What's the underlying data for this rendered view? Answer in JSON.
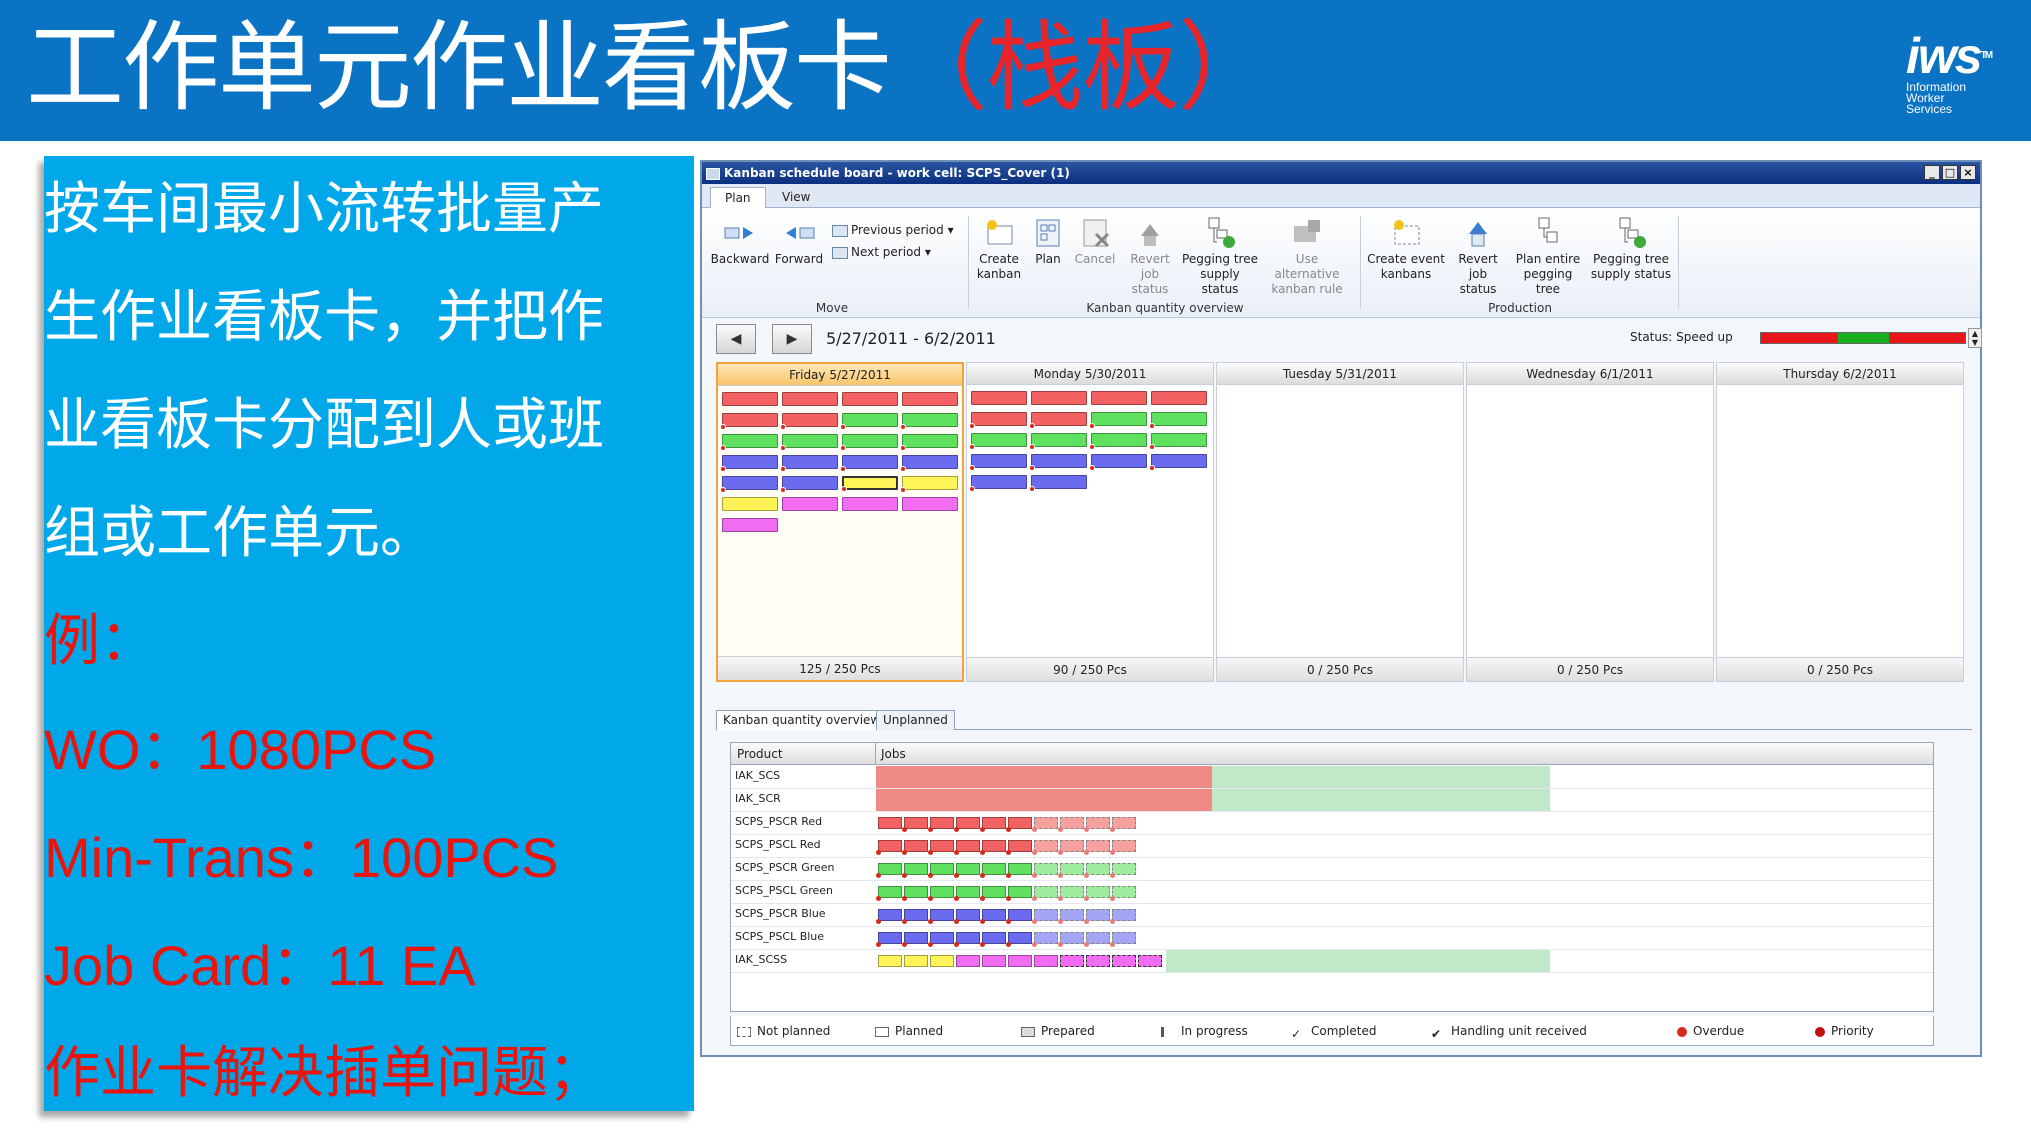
{
  "slide": {
    "title_main": "工作单元作业看板卡",
    "title_accent": "（栈板）",
    "logo": {
      "mark": "iws",
      "tm": "TM",
      "line1": "Information",
      "line2": "Worker",
      "line3": "Services"
    }
  },
  "panel": {
    "lines": [
      "按车间最小流转批量产",
      "生作业看板卡，并把作",
      "业看板卡分配到人或班",
      "组或工作单元。"
    ],
    "example_label": "例：",
    "wo": "WO：1080PCS",
    "min_trans": "Min-Trans：100PCS",
    "job_card": "Job Card：11 EA",
    "conclusion": "作业卡解决插单问题；"
  },
  "window": {
    "title": "Kanban schedule board - work cell: SCPS_Cover (1)",
    "tabs": [
      "Plan",
      "View"
    ],
    "ribbon": {
      "backward": "Backward",
      "forward": "Forward",
      "previous_period": "Previous period",
      "next_period": "Next period",
      "move_group": "Move",
      "create_kanban_1": "Create",
      "create_kanban_2": "kanban",
      "plan": "Plan",
      "cancel": "Cancel",
      "revert_job_1": "Revert job",
      "revert_job_2": "status",
      "pegging_tree_1": "Pegging tree",
      "pegging_tree_2": "supply status",
      "use_alt_1": "Use alternative",
      "use_alt_2": "kanban rule",
      "kanban_group": "Kanban quantity overview",
      "create_event_1": "Create event",
      "create_event_2": "kanbans",
      "revert_job2_1": "Revert job",
      "revert_job2_2": "status",
      "plan_entire_1": "Plan entire",
      "plan_entire_2": "pegging tree",
      "pegging_tree2_1": "Pegging tree",
      "pegging_tree2_2": "supply status",
      "production_group": "Production"
    },
    "date_range": "5/27/2011 - 6/2/2011",
    "status_label": "Status: Speed up",
    "status_colors": [
      "#e8151b",
      "#e8151b",
      "#e8151b",
      "#18b01e",
      "#18b01e",
      "#e8151b",
      "#e8151b",
      "#e8151b"
    ],
    "days": [
      {
        "label": "Friday 5/27/2011",
        "total": "125 / 250 Pcs"
      },
      {
        "label": "Monday 5/30/2011",
        "total": "90 / 250 Pcs"
      },
      {
        "label": "Tuesday 5/31/2011",
        "total": "0 / 250 Pcs"
      },
      {
        "label": "Wednesday 6/1/2011",
        "total": "0 / 250 Pcs"
      },
      {
        "label": "Thursday 6/2/2011",
        "total": "0 / 250 Pcs"
      }
    ],
    "lower_tabs": [
      "Kanban quantity overview",
      "Unplanned"
    ],
    "grid": {
      "col_product": "Product",
      "col_jobs": "Jobs",
      "rows": [
        {
          "product": "IAK_SCS",
          "color": ""
        },
        {
          "product": "IAK_SCR",
          "color": ""
        },
        {
          "product": "SCPS_PSCR",
          "color": "Red"
        },
        {
          "product": "SCPS_PSCL",
          "color": "Red"
        },
        {
          "product": "SCPS_PSCR",
          "color": "Green"
        },
        {
          "product": "SCPS_PSCL",
          "color": "Green"
        },
        {
          "product": "SCPS_PSCR",
          "color": "Blue"
        },
        {
          "product": "SCPS_PSCL",
          "color": "Blue"
        },
        {
          "product": "IAK_SCSS",
          "color": ""
        }
      ]
    },
    "legend": [
      "Not planned",
      "Planned",
      "Prepared",
      "In progress",
      "Completed",
      "Handling unit received",
      "Overdue",
      "Priority"
    ]
  },
  "colors": {
    "header_blue": "#0a73c4",
    "panel_blue": "#00a8ea",
    "accent_red": "#e8252a",
    "kanban_red": "#f26262",
    "kanban_green": "#5fe05f",
    "kanban_blue": "#6b6bf0",
    "kanban_yellow": "#fff35a",
    "kanban_magenta": "#f06cf0"
  }
}
